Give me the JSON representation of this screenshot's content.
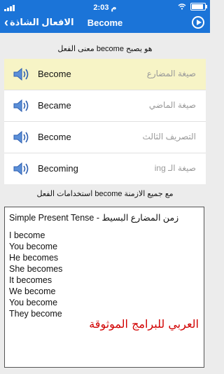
{
  "status_bar": {
    "carrier": "",
    "time": "2:03 م",
    "wifi_icon": "wifi-icon",
    "battery_icon": "battery-icon"
  },
  "nav": {
    "back_label": "الافعال الشاذة",
    "title": "Become",
    "play_icon": "play-icon"
  },
  "section1": {
    "title": "معنى الفعل become هو يصبح"
  },
  "forms": [
    {
      "word": "Become",
      "arabic": "صيغة المضارع",
      "highlight": true
    },
    {
      "word": "Became",
      "arabic": "صيغة الماضي",
      "highlight": false
    },
    {
      "word": "Become",
      "arabic": "التصريف الثالث",
      "highlight": false
    },
    {
      "word": "Becoming",
      "arabic": "صيغة الـ ing",
      "highlight": false
    }
  ],
  "section2": {
    "title": "استخدامات الفعل become مع جميع الازمنة"
  },
  "usage": {
    "header_en": "Simple Present Tense -",
    "header_ar": "زمن المضارع البسيط",
    "lines": [
      "I become",
      "You become",
      "He becomes",
      "She becomes",
      "It becomes",
      "We become",
      "You become",
      "They become"
    ]
  },
  "watermark": "العربي للبرامج الموثوقة",
  "colors": {
    "accent": "#1b74d8",
    "highlight_row": "#f7f4c6",
    "watermark": "#d10000"
  }
}
